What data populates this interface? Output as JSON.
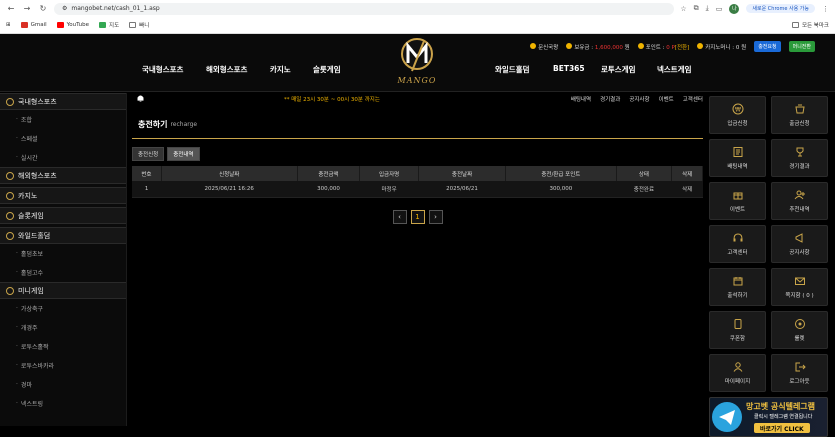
{
  "browser": {
    "url": "mangobet.net/cash_01_1.asp",
    "chrome_prompt": "새로운 Chrome 사용 가능",
    "profile_initial": "나",
    "bookmarks": [
      {
        "label": "Gmail",
        "color": "#d93025"
      },
      {
        "label": "YouTube",
        "color": "#ff0000"
      },
      {
        "label": "지도",
        "color": "#34a853"
      },
      {
        "label": "빠니",
        "color": "#777777"
      }
    ],
    "all_bookmarks": "모든 북마크"
  },
  "header": {
    "rank_label": "문신국왕",
    "balance_label": "보유금 :",
    "balance_value": "1,600,000",
    "balance_unit": "원",
    "point_label": "포인트 :",
    "point_value": "0 P",
    "point_convert": "[전환]",
    "casino_label": "카지노머니 : 0 원",
    "btn_blue": "충전요청",
    "btn_green": "머니전환",
    "logo_text": "MANGO",
    "nav": [
      "국내형스포츠",
      "해외형스포츠",
      "카지노",
      "슬롯게임",
      "와일드홀덤",
      "BET365",
      "로투스게임",
      "넥스트게임"
    ]
  },
  "sidebar": {
    "sections": [
      {
        "title": "국내형스포츠",
        "items": [
          "조합",
          "스페셜",
          "실시간"
        ]
      },
      {
        "title": "해외형스포츠",
        "items": []
      },
      {
        "title": "카지노",
        "items": []
      },
      {
        "title": "슬롯게임",
        "items": []
      },
      {
        "title": "와일드홀덤",
        "items": [
          "홀덤초보",
          "홀덤고수"
        ]
      },
      {
        "title": "미니게임",
        "items": [
          "가상축구",
          "개경주",
          "로투스홀짝",
          "로투스바카라",
          "경마",
          "넥스트링"
        ]
      }
    ]
  },
  "notice": {
    "marquee": "** 매일 23시 30분 ~ 00시 30분 까지는",
    "links": [
      "배팅내역",
      "경기결과",
      "공지사항",
      "이벤트",
      "고객센터"
    ]
  },
  "page": {
    "title": "충전하기",
    "title_en": "recharge",
    "tabs": [
      "충전신청",
      "충전내역"
    ],
    "columns": [
      "번호",
      "신청날짜",
      "충전금액",
      "입금자명",
      "충전날짜",
      "충전/환급 포인트",
      "상태",
      "삭제"
    ],
    "rows": [
      [
        "1",
        "2025/06/21 16:26",
        "300,000",
        "마정우",
        "2025/06/21",
        "300,000",
        "충전완료",
        "삭제"
      ]
    ],
    "pagination": {
      "prev": "‹",
      "current": "1",
      "next": "›"
    }
  },
  "quick_menu": [
    {
      "label": "입금신청",
      "icon": "deposit-icon"
    },
    {
      "label": "출금신청",
      "icon": "withdraw-icon"
    },
    {
      "label": "배팅내역",
      "icon": "bet-history-icon"
    },
    {
      "label": "경기결과",
      "icon": "trophy-icon"
    },
    {
      "label": "이벤트",
      "icon": "gift-icon"
    },
    {
      "label": "추천내역",
      "icon": "user-plus-icon"
    },
    {
      "label": "고객센터",
      "icon": "headset-icon"
    },
    {
      "label": "공지사항",
      "icon": "megaphone-icon"
    },
    {
      "label": "출석하기",
      "icon": "calendar-icon"
    },
    {
      "label": "쪽지함 ( 0 )",
      "icon": "mail-icon"
    },
    {
      "label": "쿠폰함",
      "icon": "coupon-icon"
    },
    {
      "label": "룰렛",
      "icon": "roulette-icon"
    },
    {
      "label": "마이페이지",
      "icon": "user-icon"
    },
    {
      "label": "로그아웃",
      "icon": "logout-icon"
    }
  ],
  "telegram": {
    "title": "망고벳 공식텔레그램",
    "subtitle": "클릭시 텔레그램 연결됩니다",
    "button": "바로가기 CLICK"
  },
  "colors": {
    "accent": "#c9a54a",
    "highlight": "#f0b400"
  }
}
